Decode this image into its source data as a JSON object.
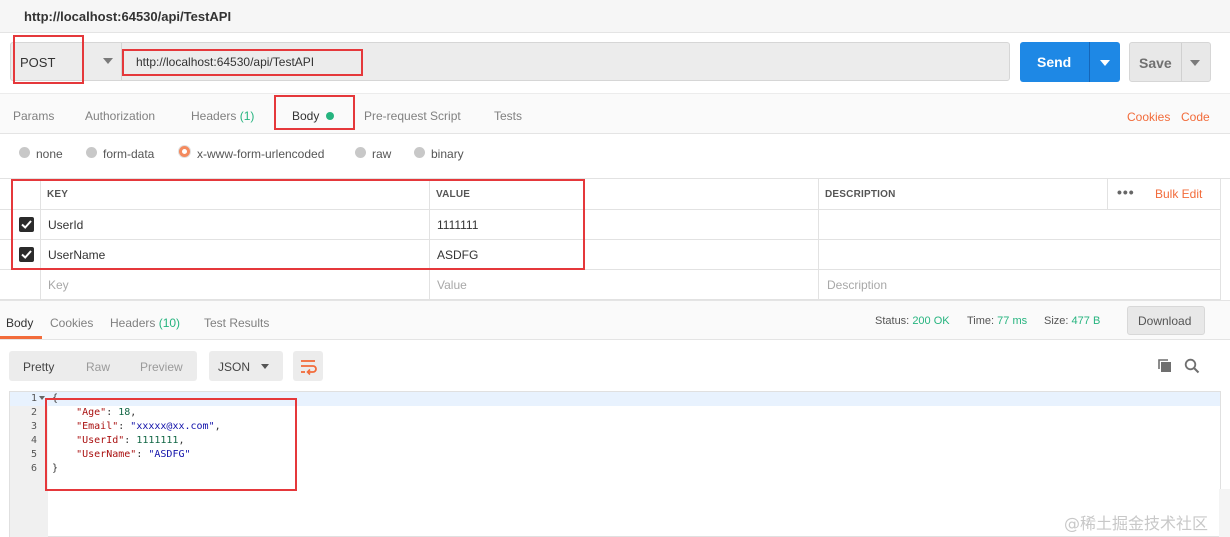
{
  "window": {
    "title": "http://localhost:64530/api/TestAPI"
  },
  "request": {
    "method": "POST",
    "url": "http://localhost:64530/api/TestAPI",
    "send_label": "Send",
    "save_label": "Save"
  },
  "request_tabs": {
    "params": "Params",
    "authorization": "Authorization",
    "headers": "Headers",
    "headers_count": "(1)",
    "body": "Body",
    "prerequest": "Pre-request Script",
    "tests": "Tests",
    "cookies": "Cookies",
    "code": "Code"
  },
  "body_types": {
    "none": "none",
    "form_data": "form-data",
    "urlencoded": "x-www-form-urlencoded",
    "raw": "raw",
    "binary": "binary",
    "selected": "x-www-form-urlencoded"
  },
  "kv_table": {
    "headers": {
      "key": "KEY",
      "value": "VALUE",
      "description": "DESCRIPTION"
    },
    "more_icon": "more-dots-icon",
    "bulk_edit": "Bulk Edit",
    "rows": [
      {
        "checked": true,
        "key": "UserId",
        "value": "1111111"
      },
      {
        "checked": true,
        "key": "UserName",
        "value": "ASDFG"
      }
    ],
    "placeholders": {
      "key": "Key",
      "value": "Value",
      "description": "Description"
    }
  },
  "response_tabs": {
    "body": "Body",
    "cookies": "Cookies",
    "headers": "Headers",
    "headers_count": "(10)",
    "test_results": "Test Results"
  },
  "response_status": {
    "status_label": "Status:",
    "status_value": "200 OK",
    "time_label": "Time:",
    "time_value": "77 ms",
    "size_label": "Size:",
    "size_value": "477 B",
    "download": "Download"
  },
  "view_modes": {
    "pretty": "Pretty",
    "raw": "Raw",
    "preview": "Preview",
    "format": "JSON"
  },
  "code_lines": [
    {
      "n": "1",
      "text": "{"
    },
    {
      "n": "2",
      "key": "\"Age\"",
      "val": "18",
      "type": "num",
      "trail": ","
    },
    {
      "n": "3",
      "key": "\"Email\"",
      "val": "\"xxxxx@xx.com\"",
      "type": "str",
      "trail": ","
    },
    {
      "n": "4",
      "key": "\"UserId\"",
      "val": "1111111",
      "type": "num",
      "trail": ","
    },
    {
      "n": "5",
      "key": "\"UserName\"",
      "val": "\"ASDFG\"",
      "type": "str",
      "trail": ""
    },
    {
      "n": "6",
      "text": "}"
    }
  ],
  "watermark": "@稀土掘金技术社区",
  "colors": {
    "accent": "#f26b3a",
    "send": "#1e88e5",
    "green": "#26b47f",
    "highlight_box": "#e5383b"
  }
}
